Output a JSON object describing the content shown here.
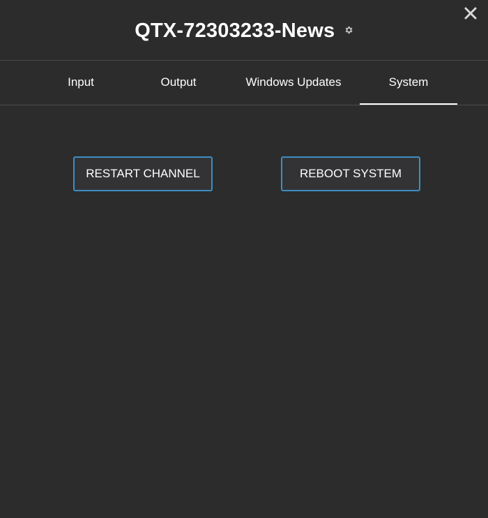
{
  "dialog": {
    "title": "QTX-72303233-News",
    "gear_icon": "gear-icon",
    "close_icon": "close-icon"
  },
  "tabs": [
    {
      "label": "Input",
      "active": false
    },
    {
      "label": "Output",
      "active": false
    },
    {
      "label": "Windows Updates",
      "active": false
    },
    {
      "label": "System",
      "active": true
    }
  ],
  "system": {
    "restart_channel_label": "RESTART CHANNEL",
    "reboot_system_label": "REBOOT SYSTEM"
  },
  "colors": {
    "background": "#2c2c2c",
    "button_border": "#3c8fc4",
    "text": "#ffffff"
  }
}
